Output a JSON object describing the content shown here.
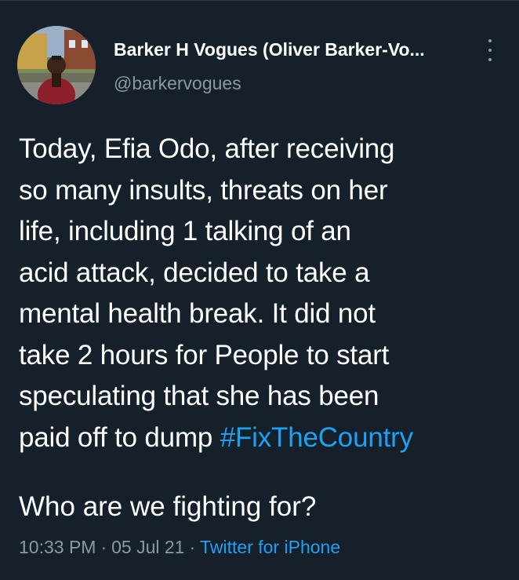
{
  "author": {
    "display_name": "Barker H Vogues (Oliver Barker-Vo...",
    "handle": "@barkervogues"
  },
  "tweet": {
    "lines": [
      "Today, Efia Odo, after receiving",
      "so many insults, threats on her",
      "life, including 1 talking of an",
      "acid attack, decided to take a",
      "mental health break. It did not",
      "take 2 hours for People to start",
      "speculating that she has been"
    ],
    "last_line_prefix": "paid off to dump ",
    "hashtag": "#FixTheCountry",
    "question": "Who are we fighting for?"
  },
  "meta": {
    "time": "10:33 PM",
    "separator": "·",
    "date": "05 Jul 21",
    "source": "Twitter for iPhone"
  },
  "colors": {
    "background": "#15202b",
    "text": "#ffffff",
    "secondary": "#8899a6",
    "accent": "#1da1f2"
  },
  "icons": {
    "more": "more-vertical-icon"
  }
}
